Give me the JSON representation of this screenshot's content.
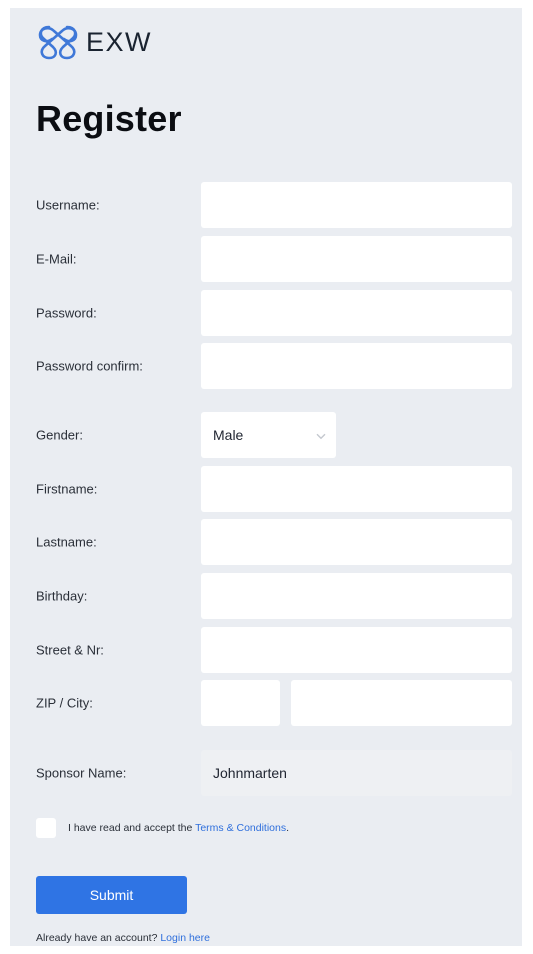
{
  "brand": {
    "name": "EXW",
    "logo_icon": "exw-logo-icon",
    "accent": "#2f74e4"
  },
  "page_title": "Register",
  "fields": {
    "username": {
      "label": "Username:",
      "value": ""
    },
    "email": {
      "label": "E-Mail:",
      "value": ""
    },
    "password": {
      "label": "Password:",
      "value": ""
    },
    "password_confirm": {
      "label": "Password confirm:",
      "value": ""
    },
    "gender": {
      "label": "Gender:",
      "value": "Male",
      "icon": "chevron-down-icon"
    },
    "firstname": {
      "label": "Firstname:",
      "value": ""
    },
    "lastname": {
      "label": "Lastname:",
      "value": ""
    },
    "birthday": {
      "label": "Birthday:",
      "value": ""
    },
    "street": {
      "label": "Street & Nr:",
      "value": ""
    },
    "zip_city": {
      "label": "ZIP / City:",
      "zip_value": "",
      "city_value": ""
    },
    "sponsor": {
      "label": "Sponsor Name:",
      "value": "Johnmarten"
    }
  },
  "terms": {
    "prefix": "I have read and accept the ",
    "link_text": "Terms & Conditions",
    "suffix": "."
  },
  "submit_label": "Submit",
  "login": {
    "prefix": "Already have an account? ",
    "link_text": "Login here"
  }
}
